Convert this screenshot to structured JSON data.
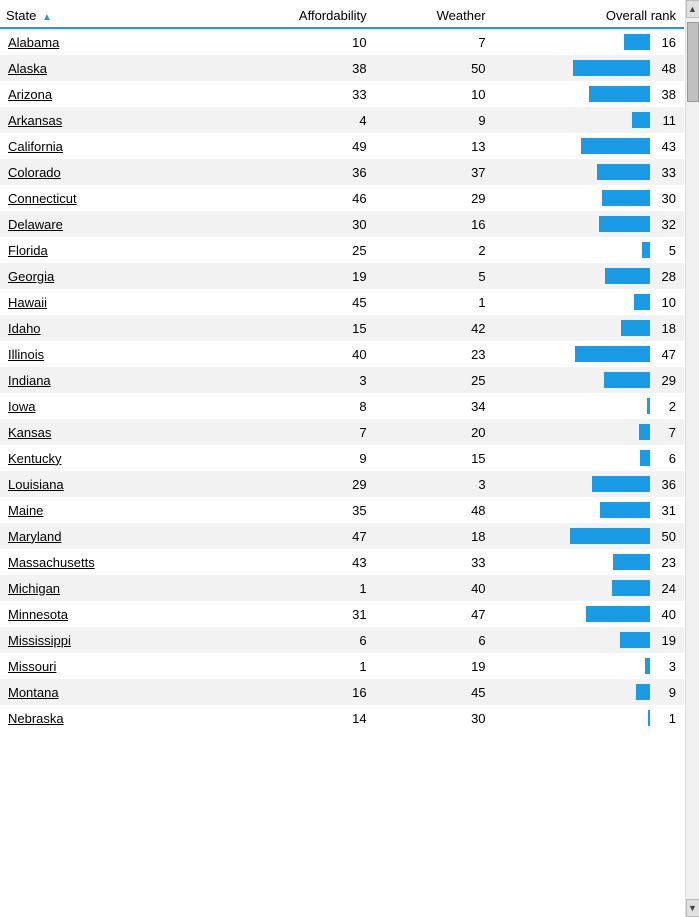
{
  "header": {
    "state_label": "State",
    "affordability_label": "Affordability",
    "weather_label": "Weather",
    "overall_label": "Overall rank",
    "sort_indicator": "▲"
  },
  "rows": [
    {
      "state": "Alabama",
      "affordability": 10,
      "weather": 7,
      "overall": 16
    },
    {
      "state": "Alaska",
      "affordability": 38,
      "weather": 50,
      "overall": 48
    },
    {
      "state": "Arizona",
      "affordability": 33,
      "weather": 10,
      "overall": 38
    },
    {
      "state": "Arkansas",
      "affordability": 4,
      "weather": 9,
      "overall": 11
    },
    {
      "state": "California",
      "affordability": 49,
      "weather": 13,
      "overall": 43
    },
    {
      "state": "Colorado",
      "affordability": 36,
      "weather": 37,
      "overall": 33
    },
    {
      "state": "Connecticut",
      "affordability": 46,
      "weather": 29,
      "overall": 30
    },
    {
      "state": "Delaware",
      "affordability": 30,
      "weather": 16,
      "overall": 32
    },
    {
      "state": "Florida",
      "affordability": 25,
      "weather": 2,
      "overall": 5
    },
    {
      "state": "Georgia",
      "affordability": 19,
      "weather": 5,
      "overall": 28
    },
    {
      "state": "Hawaii",
      "affordability": 45,
      "weather": 1,
      "overall": 10
    },
    {
      "state": "Idaho",
      "affordability": 15,
      "weather": 42,
      "overall": 18
    },
    {
      "state": "Illinois",
      "affordability": 40,
      "weather": 23,
      "overall": 47
    },
    {
      "state": "Indiana",
      "affordability": 3,
      "weather": 25,
      "overall": 29
    },
    {
      "state": "Iowa",
      "affordability": 8,
      "weather": 34,
      "overall": 2
    },
    {
      "state": "Kansas",
      "affordability": 7,
      "weather": 20,
      "overall": 7
    },
    {
      "state": "Kentucky",
      "affordability": 9,
      "weather": 15,
      "overall": 6
    },
    {
      "state": "Louisiana",
      "affordability": 29,
      "weather": 3,
      "overall": 36
    },
    {
      "state": "Maine",
      "affordability": 35,
      "weather": 48,
      "overall": 31
    },
    {
      "state": "Maryland",
      "affordability": 47,
      "weather": 18,
      "overall": 50
    },
    {
      "state": "Massachusetts",
      "affordability": 43,
      "weather": 33,
      "overall": 23
    },
    {
      "state": "Michigan",
      "affordability": 1,
      "weather": 40,
      "overall": 24
    },
    {
      "state": "Minnesota",
      "affordability": 31,
      "weather": 47,
      "overall": 40
    },
    {
      "state": "Mississippi",
      "affordability": 6,
      "weather": 6,
      "overall": 19
    },
    {
      "state": "Missouri",
      "affordability": 1,
      "weather": 19,
      "overall": 3
    },
    {
      "state": "Montana",
      "affordability": 16,
      "weather": 45,
      "overall": 9
    },
    {
      "state": "Nebraska",
      "affordability": 14,
      "weather": 30,
      "overall": 1
    }
  ],
  "max_overall": 50,
  "bar_scale": 80
}
